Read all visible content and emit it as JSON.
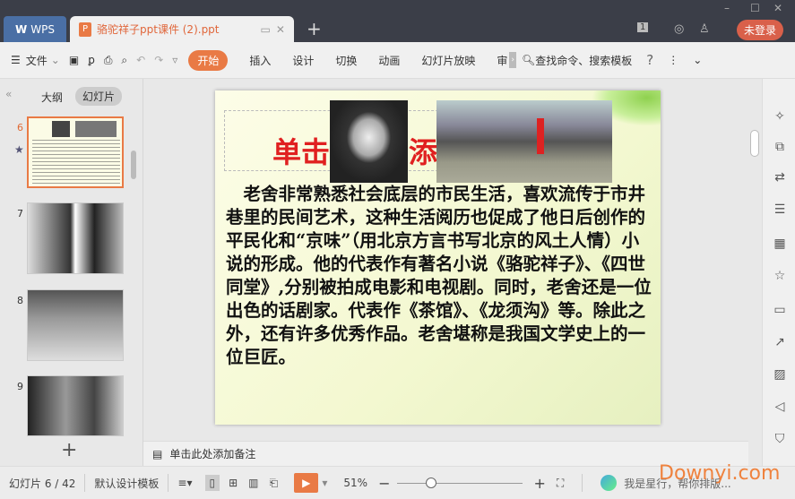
{
  "titlebar": {
    "app_tab": "WPS",
    "doc_tab": "骆驼祥子ppt课件 (2).ppt",
    "login": "未登录",
    "badge": "1"
  },
  "toolbar": {
    "file": "文件",
    "tabs": [
      "开始",
      "插入",
      "设计",
      "切换",
      "动画",
      "幻灯片放映",
      "审"
    ],
    "search": "查找命令、搜索模板",
    "help": "?"
  },
  "left_panel": {
    "tabs": [
      "大纲",
      "幻灯片"
    ],
    "slides": [
      "6",
      "7",
      "8",
      "9"
    ]
  },
  "slide": {
    "title_left": "单击",
    "title_right": "添",
    "body": "老舍非常熟悉社会底层的市民生活，喜欢流传于市井巷里的民间艺术，这种生活阅历也促成了他日后创作的平民化和“京味”（用北京方言书写北京的风土人情）小说的形成。他的代表作有著名小说《骆驼祥子》、《四世同堂》,分别被拍成电影和电视剧。同时，老舍还是一位出色的话剧家。代表作《茶馆》、《龙须沟》等。除此之外，还有许多优秀作品。老舍堪称是我国文学史上的一位巨匠。"
  },
  "notes": {
    "placeholder": "单击此处添加备注"
  },
  "status": {
    "slide_count": "幻灯片 6 / 42",
    "template": "默认设计模板",
    "zoom": "51%",
    "assistant": "我是星行，帮你排版...",
    "watermark": "Downyi.com",
    "zoom_fraction": 0.25
  },
  "colors": {
    "accent": "#e97a45",
    "title_red": "#e02020"
  }
}
